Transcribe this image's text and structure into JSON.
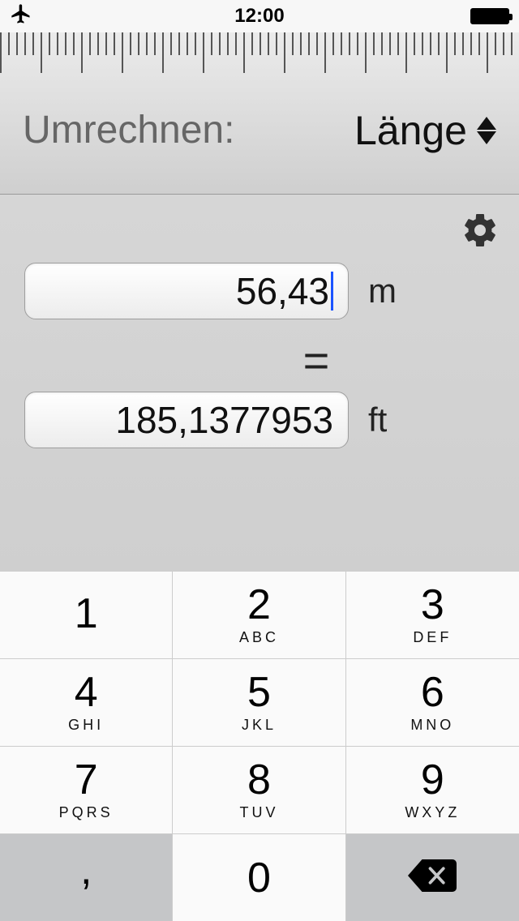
{
  "status": {
    "time": "12:00"
  },
  "header": {
    "convert_label": "Umrechnen:",
    "category": "Länge"
  },
  "conversion": {
    "input_value": "56,43",
    "input_unit": "m",
    "equals": "=",
    "output_value": "185,1377953",
    "output_unit": "ft"
  },
  "keypad": {
    "keys": [
      {
        "digit": "1",
        "letters": ""
      },
      {
        "digit": "2",
        "letters": "ABC"
      },
      {
        "digit": "3",
        "letters": "DEF"
      },
      {
        "digit": "4",
        "letters": "GHI"
      },
      {
        "digit": "5",
        "letters": "JKL"
      },
      {
        "digit": "6",
        "letters": "MNO"
      },
      {
        "digit": "7",
        "letters": "PQRS"
      },
      {
        "digit": "8",
        "letters": "TUV"
      },
      {
        "digit": "9",
        "letters": "WXYZ"
      }
    ],
    "decimal": ",",
    "zero": "0"
  }
}
